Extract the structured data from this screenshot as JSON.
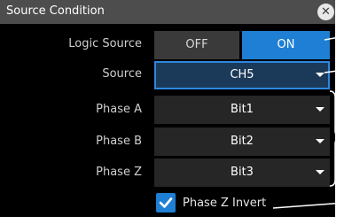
{
  "dialog": {
    "title": "Source Condition",
    "close_icon": "close-icon"
  },
  "logic_source": {
    "label": "Logic Source",
    "off_label": "OFF",
    "on_label": "ON",
    "selected": "ON"
  },
  "source": {
    "label": "Source",
    "value": "CH5"
  },
  "phase_a": {
    "label": "Phase A",
    "value": "Bit1"
  },
  "phase_b": {
    "label": "Phase B",
    "value": "Bit2"
  },
  "phase_z": {
    "label": "Phase Z",
    "value": "Bit3"
  },
  "phase_z_invert": {
    "label": "Phase Z Invert",
    "checked": true
  },
  "colors": {
    "accent": "#1f7fd4",
    "titlebar": "#4d4d4d",
    "background": "#000000"
  }
}
